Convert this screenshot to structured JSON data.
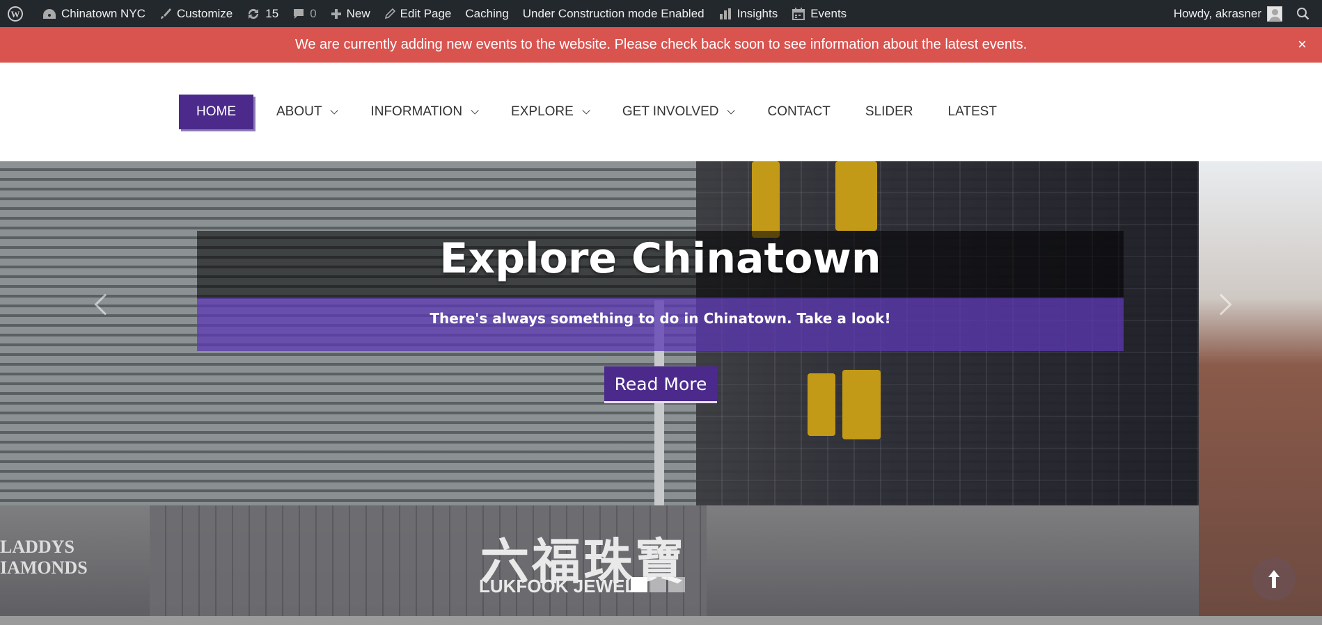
{
  "adminbar": {
    "site_name": "Chinatown NYC",
    "customize": "Customize",
    "updates_count": "15",
    "comments_count": "0",
    "new": "New",
    "edit_page": "Edit Page",
    "caching": "Caching",
    "under_construction": "Under Construction mode Enabled",
    "insights": "Insights",
    "events": "Events",
    "howdy": "Howdy, akrasner"
  },
  "notice": {
    "text": "We are currently adding new events to the website. Please check back soon to see information about the latest events.",
    "close": "×"
  },
  "menu": {
    "items": [
      {
        "label": "HOME",
        "active": true
      },
      {
        "label": "ABOUT"
      },
      {
        "label": "INFORMATION"
      },
      {
        "label": "EXPLORE"
      },
      {
        "label": "GET INVOLVED"
      },
      {
        "label": "CONTACT"
      },
      {
        "label": "SLIDER"
      },
      {
        "label": "LATEST"
      }
    ]
  },
  "hero": {
    "title": "Explore Chinatown",
    "subtitle": "There's always something to do in Chinatown. Take a look!",
    "button": "Read More",
    "photo_text": {
      "sign_chars": "六福珠寶",
      "sign_latin": "LUKFOOK JEWELL",
      "laddys_line1": "LADDYS",
      "laddys_line2": "IAMONDS"
    }
  },
  "colors": {
    "adminbar_bg": "#23282d",
    "notice_bg": "#d9534f",
    "brand_purple": "#4b2a8c"
  }
}
